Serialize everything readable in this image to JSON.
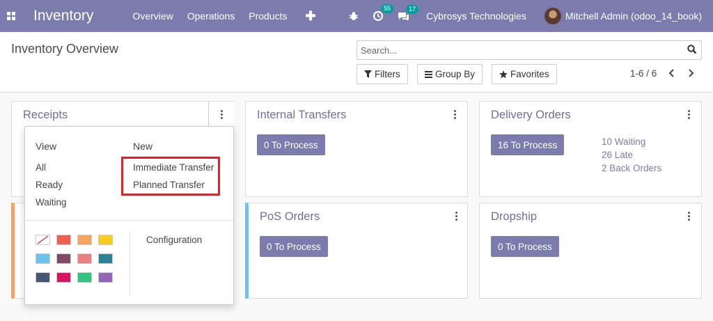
{
  "navbar": {
    "app_name": "Inventory",
    "menu": [
      "Overview",
      "Operations",
      "Products"
    ],
    "plus": "✚",
    "activity_count": "55",
    "message_count": "17",
    "company": "Cybrosys Technologies",
    "user": "Mitchell Admin (odoo_14_book)"
  },
  "control": {
    "title": "Inventory Overview",
    "search_placeholder": "Search...",
    "filters": "Filters",
    "group_by": "Group By",
    "favorites": "Favorites",
    "pager": "1-6 / 6"
  },
  "cards": {
    "receipts": {
      "title": "Receipts"
    },
    "internal": {
      "title": "Internal Transfers",
      "button": "0 To Process"
    },
    "delivery": {
      "title": "Delivery Orders",
      "button": "16 To Process",
      "stats": [
        "10 Waiting",
        "26 Late",
        "2 Back Orders"
      ]
    },
    "pos": {
      "title": "PoS Orders",
      "button": "0 To Process"
    },
    "dropship": {
      "title": "Dropship",
      "button": "0 To Process"
    }
  },
  "dropdown": {
    "view_header": "View",
    "new_header": "New",
    "view_items": [
      "All",
      "Ready",
      "Waiting"
    ],
    "new_items": [
      "Immediate Transfer",
      "Planned Transfer"
    ],
    "configuration": "Configuration",
    "colors": [
      "none",
      "#f06050",
      "#f4a460",
      "#f7cd1f",
      "#6cc1ed",
      "#814968",
      "#eb7e7f",
      "#2c8397",
      "#475577",
      "#d6145f",
      "#30c381",
      "#9365b8"
    ]
  },
  "colors": {
    "brand": "#7c7bad",
    "highlight_box": "#e01f26",
    "receipts_stripe": "#f4a460",
    "pos_stripe": "#6cc1ed"
  }
}
